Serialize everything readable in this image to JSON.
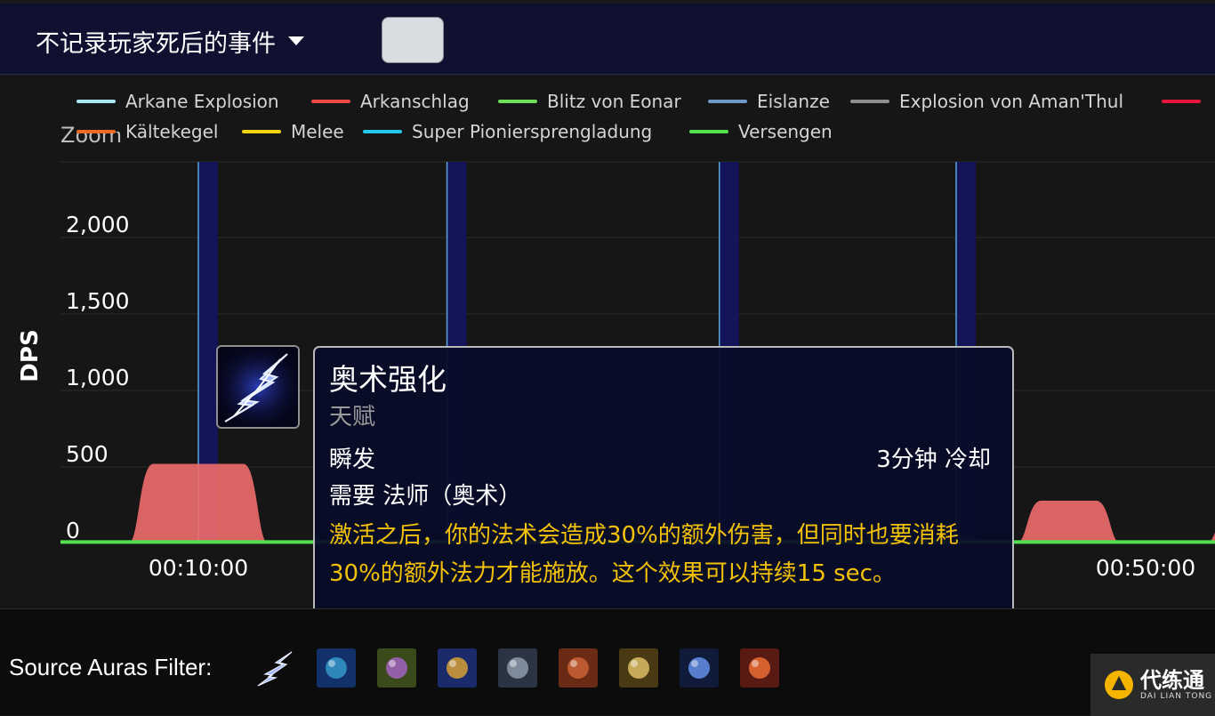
{
  "toolbar": {
    "dropdown_label": "不记录玩家死后的事件"
  },
  "chart_data": {
    "type": "area",
    "ylabel": "DPS",
    "yticks": [
      0,
      500,
      1000,
      1500,
      2000
    ],
    "ytick_labels": [
      "0",
      "500",
      "1,000",
      "1,500",
      "2,000"
    ],
    "xticks_visible": [
      "00:10:00",
      "00:50:00"
    ],
    "overlay_label": "Zoom",
    "legend": [
      {
        "name": "Arkane Explosion",
        "color": "#a9e8f2"
      },
      {
        "name": "Arkanschlag",
        "color": "#ef4b46"
      },
      {
        "name": "Blitz von Eonar",
        "color": "#6ee05a"
      },
      {
        "name": "Eislanze",
        "color": "#6f98c8"
      },
      {
        "name": "Explosion von Aman'Thul",
        "color": "#8e8e8e"
      },
      {
        "name": "",
        "color": "#e5163a"
      },
      {
        "name": "Kältekegel",
        "color": "#ee6a24"
      },
      {
        "name": "Melee",
        "color": "#f1d514"
      },
      {
        "name": "Super Pioniersprengladung",
        "color": "#22c9ec"
      },
      {
        "name": "Versengen",
        "color": "#53e14f"
      }
    ],
    "series": [
      {
        "name": "Arkanschlag",
        "color": "#ef6b6b",
        "bursts": [
          {
            "start": "00:07:30",
            "end": "00:12:30",
            "value": 520
          },
          {
            "start": "00:45:00",
            "end": "00:48:30",
            "value": 280
          },
          {
            "start": "00:53:00",
            "end": "00:54:00",
            "value": 220
          }
        ]
      },
      {
        "name": "Versengen",
        "color": "#53e14f",
        "baseline": 15
      }
    ],
    "markers": [
      "00:10:00",
      "00:20:30",
      "00:32:00",
      "00:42:00"
    ]
  },
  "tooltip": {
    "title": "奥术强化",
    "subtitle": "天赋",
    "cast": "瞬发",
    "cooldown": "3分钟 冷却",
    "requires": "需要 法师（奥术）",
    "description": "激活之后，你的法术会造成30%的额外伤害，但同时也要消耗30%的额外法力才能施放。这个效果可以持续15 sec。",
    "icon": "arcane-power-icon"
  },
  "bottom": {
    "filter_label": "Source Auras Filter:",
    "auras": [
      {
        "icon": "arcane-power-icon"
      },
      {
        "icon": "rune-of-power-icon"
      },
      {
        "icon": "mana-gem-icon"
      },
      {
        "icon": "evocation-icon"
      },
      {
        "icon": "helmet-icon"
      },
      {
        "icon": "elixir-icon"
      },
      {
        "icon": "cheese-icon"
      },
      {
        "icon": "orb-icon"
      },
      {
        "icon": "potion-icon"
      }
    ],
    "logo_name": "代练通",
    "logo_sub": "DAI LIAN TONG"
  }
}
